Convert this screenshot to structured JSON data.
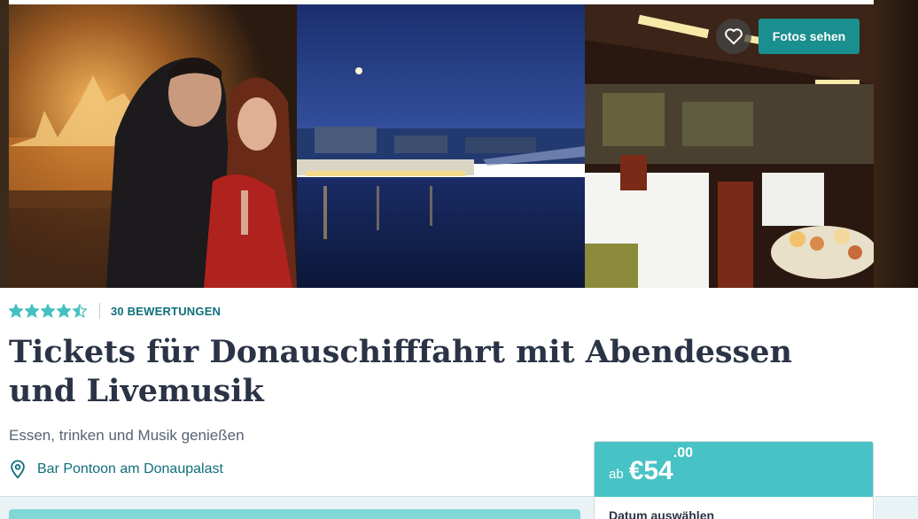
{
  "gallery": {
    "favorite_icon": "heart-outline-icon",
    "photos_button_label": "Fotos sehen"
  },
  "rating": {
    "stars": 4.5,
    "max_stars": 5,
    "star_color": "#45c0c2",
    "reviews_label": "30 BEWERTUNGEN"
  },
  "product": {
    "title": "Tickets für Donauschifffahrt mit Abendessen und Livemusik",
    "subtitle": "Essen, trinken und Musik genießen",
    "location": "Bar Pontoon am Donaupalast",
    "location_icon": "map-pin-icon"
  },
  "booking": {
    "price_prefix": "ab",
    "price_main": "€54",
    "price_cents": ".00",
    "date_label": "Datum auswählen",
    "accent_color": "#47c2c5"
  },
  "colors": {
    "brand_teal": "#1a8f8f",
    "link_teal": "#0f6f7a",
    "title_color": "#2b3446"
  }
}
